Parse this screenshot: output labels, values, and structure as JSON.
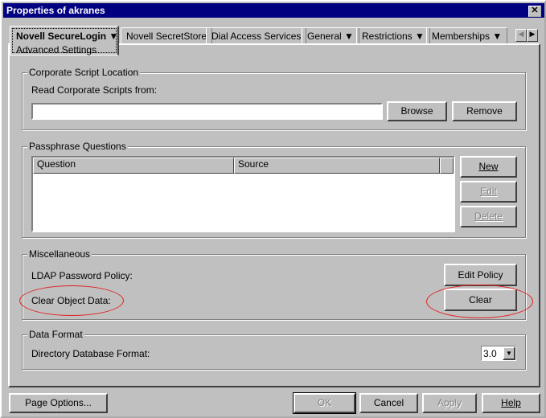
{
  "window": {
    "title": "Properties of akranes"
  },
  "tabs": [
    {
      "label": "Novell SecureLogin",
      "sub": "Advanced Settings",
      "dropdown": true,
      "active": true
    },
    {
      "label": "Novell SecretStore"
    },
    {
      "label": "Dial Access Services"
    },
    {
      "label": "General",
      "dropdown": true
    },
    {
      "label": "Restrictions",
      "dropdown": true
    },
    {
      "label": "Memberships",
      "dropdown": true
    }
  ],
  "corporate": {
    "title": "Corporate Script Location",
    "label": "Read Corporate Scripts from:",
    "value": "",
    "browse": "Browse",
    "remove": "Remove"
  },
  "passphrase": {
    "title": "Passphrase Questions",
    "columns": [
      "Question",
      "Source"
    ],
    "rows": [],
    "new": "New",
    "edit": "Edit",
    "delete": "Delete"
  },
  "misc": {
    "title": "Miscellaneous",
    "ldap_label": "LDAP Password Policy:",
    "edit_policy": "Edit Policy",
    "clear_label": "Clear Object Data:",
    "clear": "Clear",
    "highlight_color": "#e02020"
  },
  "dataformat": {
    "title": "Data Format",
    "label": "Directory Database Format:",
    "value": "3.0"
  },
  "footer": {
    "page_options": "Page Options...",
    "ok": "OK",
    "cancel": "Cancel",
    "apply": "Apply",
    "help": "Help"
  }
}
